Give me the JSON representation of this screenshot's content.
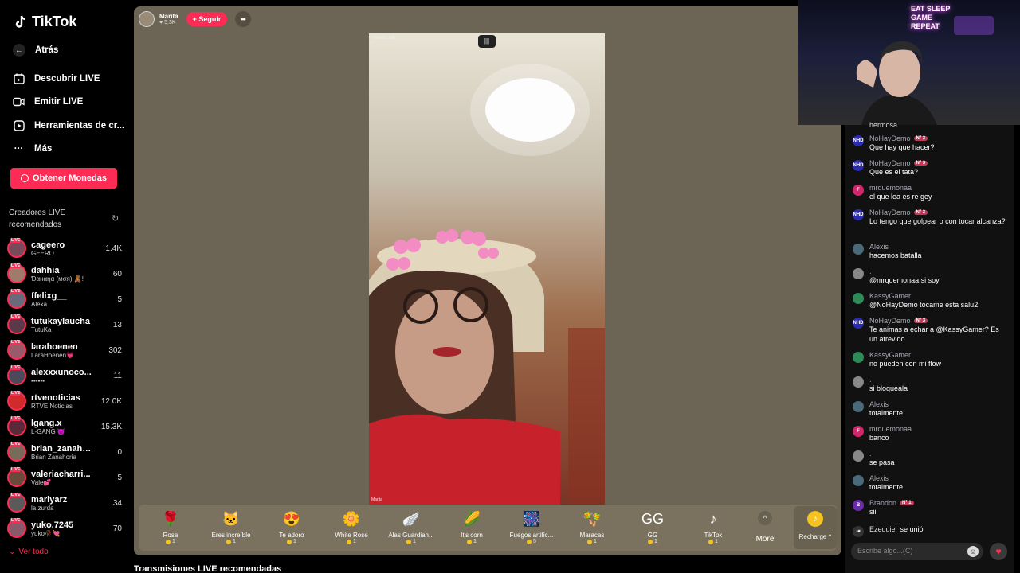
{
  "app": {
    "logo": "TikTok"
  },
  "sidebar": {
    "back": "Atrás",
    "nav": [
      {
        "label": "Descubrir LIVE",
        "icon": "calendar-icon"
      },
      {
        "label": "Emitir LIVE",
        "icon": "camera-icon"
      },
      {
        "label": "Herramientas de cr...",
        "icon": "play-box-icon"
      },
      {
        "label": "Más",
        "icon": "more-dots-icon"
      }
    ],
    "coins_button": "Obtener Monedas",
    "rec_title": "Creadores LIVE recomendados",
    "see_all": "Ver todo",
    "creators": [
      {
        "name": "cageero",
        "sub": "GEERO",
        "count": "1.4K"
      },
      {
        "name": "dahhia",
        "sub": "Ɗαнαηα (мσя) 🧸!",
        "count": "60"
      },
      {
        "name": "ffelixg__",
        "sub": "Alexa",
        "count": "5"
      },
      {
        "name": "tutukaylaucha",
        "sub": "TutuKa",
        "count": "13"
      },
      {
        "name": "larahoenen",
        "sub": "LaraHoenen💗",
        "count": "302"
      },
      {
        "name": "alexxxunoco...",
        "sub": "▪▪▪▪▪▪",
        "count": "11"
      },
      {
        "name": "rtvenoticias",
        "sub": "RTVE Noticias",
        "count": "12.0K"
      },
      {
        "name": "lgang.x",
        "sub": "L-GANG 😈",
        "count": "15.3K"
      },
      {
        "name": "brian_zanaho...",
        "sub": "Brian Zanahoria",
        "count": "0"
      },
      {
        "name": "valeriacharri...",
        "sub": "Vale💕",
        "count": "5"
      },
      {
        "name": "marlyarz",
        "sub": "la zurda",
        "count": "34"
      },
      {
        "name": "yuko.7245",
        "sub": "yuko🥀💘",
        "count": "70"
      }
    ]
  },
  "stream": {
    "host_name": "Marita",
    "host_likes": "5.3K",
    "follow": "+ Seguir",
    "video_label_top": "Creator LIVE",
    "video_label_bottom": "Marita",
    "gifts": [
      {
        "name": "Rosa",
        "price": "1",
        "icon": "🌹"
      },
      {
        "name": "Eres increíble",
        "price": "1",
        "icon": "🐱"
      },
      {
        "name": "Te adoro",
        "price": "1",
        "icon": "😍"
      },
      {
        "name": "White Rose",
        "price": "1",
        "icon": "🌼"
      },
      {
        "name": "Alas Guardian...",
        "price": "1",
        "icon": "🪽"
      },
      {
        "name": "It's corn",
        "price": "1",
        "icon": "🌽"
      },
      {
        "name": "Fuegos artific...",
        "price": "5",
        "icon": "🎆"
      },
      {
        "name": "Maracas",
        "price": "1",
        "icon": "🪇"
      },
      {
        "name": "GG",
        "price": "1",
        "icon": "GG"
      },
      {
        "name": "TikTok",
        "price": "1",
        "icon": "♪"
      }
    ],
    "more": "More",
    "recharge": "Recharge ^",
    "below_title": "Transmisiones LIVE recomendadas"
  },
  "webcam": {
    "neon": "EAT SLEEP GAME REPEAT"
  },
  "chat": {
    "top_fragment": "hermosa",
    "messages": [
      {
        "user": "NoHayDemo",
        "badge": "Nº 3",
        "text": "Que hay que hacer?",
        "av": "NHD",
        "color": "#2b2bb0"
      },
      {
        "user": "NoHayDemo",
        "badge": "Nº 3",
        "text": "Que es el tata?",
        "av": "NHD",
        "color": "#2b2bb0"
      },
      {
        "user": "mrquemonaa",
        "badge": "",
        "text": "el que lea es re gey",
        "av": "F",
        "color": "#d1266b"
      },
      {
        "user": "NoHayDemo",
        "badge": "Nº 3",
        "text": "Lo tengo que golpear o con tocar alcanza?",
        "av": "NHD",
        "color": "#2b2bb0"
      },
      {
        "user": "Alexis",
        "badge": "",
        "text": "hacemos batalla",
        "av": "",
        "color": "#4a6a7a"
      },
      {
        "user": ".",
        "badge": "",
        "text": "@mrquemonaa si soy",
        "av": "",
        "color": "#888"
      },
      {
        "user": "KassyGamer",
        "badge": "",
        "text": "@NoHayDemo tocame esta salu2",
        "av": "",
        "color": "#2e8b57"
      },
      {
        "user": "NoHayDemo",
        "badge": "Nº 3",
        "text": "Te animas a echar a @KassyGamer? Es un atrevido",
        "av": "NHD",
        "color": "#2b2bb0"
      },
      {
        "user": "KassyGamer",
        "badge": "",
        "text": "no pueden con mi flow",
        "av": "",
        "color": "#2e8b57"
      },
      {
        "user": ".",
        "badge": "",
        "text": "si bloqueala",
        "av": "",
        "color": "#888"
      },
      {
        "user": "Alexis",
        "badge": "",
        "text": "totalmente",
        "av": "",
        "color": "#4a6a7a"
      },
      {
        "user": "mrquemonaa",
        "badge": "",
        "text": "banco",
        "av": "F",
        "color": "#d1266b"
      },
      {
        "user": ".",
        "badge": "",
        "text": "se pasa",
        "av": "",
        "color": "#888"
      },
      {
        "user": "Alexis",
        "badge": "",
        "text": "totalmente",
        "av": "",
        "color": "#4a6a7a"
      },
      {
        "user": "Brandon",
        "badge": "Nº 1",
        "text": "sii",
        "av": "B",
        "color": "#6a2ca8"
      }
    ],
    "join_user": "Ezequiel",
    "join_text": "se unió",
    "input_placeholder": "Escribe algo...(C)"
  }
}
